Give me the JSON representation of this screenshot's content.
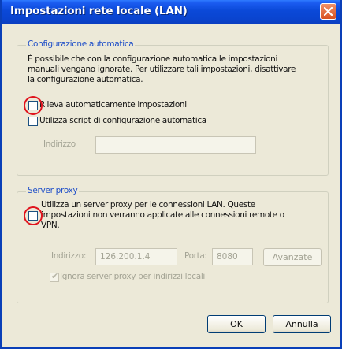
{
  "window": {
    "title": "Impostazioni rete locale (LAN)",
    "close_icon": "close-icon"
  },
  "auto_config": {
    "legend": "Configurazione automatica",
    "description_lines": [
      "È possibile che con la configurazione automatica le impostazioni",
      "manuali vengano ignorate. Per utilizzare tali impostazioni, disattivare",
      "la configurazione automatica."
    ],
    "detect_settings_label": "Rileva automaticamente impostazioni",
    "detect_settings_checked": false,
    "use_script_label": "Utilizza script di configurazione automatica",
    "use_script_checked": false,
    "address_label": "Indirizzo",
    "address_value": ""
  },
  "proxy": {
    "legend": "Server proxy",
    "use_proxy_lines": [
      "Utilizza un server proxy per le connessioni LAN. Queste",
      "impostazioni non verranno applicate alle connessioni remote o",
      "VPN."
    ],
    "use_proxy_checked": false,
    "address_label": "Indirizzo:",
    "address_value": "126.200.1.4",
    "port_label": "Porta:",
    "port_value": "8080",
    "advanced_label": "Avanzate",
    "bypass_label": "Ignora server proxy per indirizzi locali",
    "bypass_checked": true
  },
  "buttons": {
    "ok": "OK",
    "cancel": "Annulla"
  },
  "colors": {
    "titlebar": "#0a44cf",
    "legend_text": "#1f4fc8",
    "highlight_ring": "#e0141d",
    "dialog_bg": "#ece9d8"
  }
}
